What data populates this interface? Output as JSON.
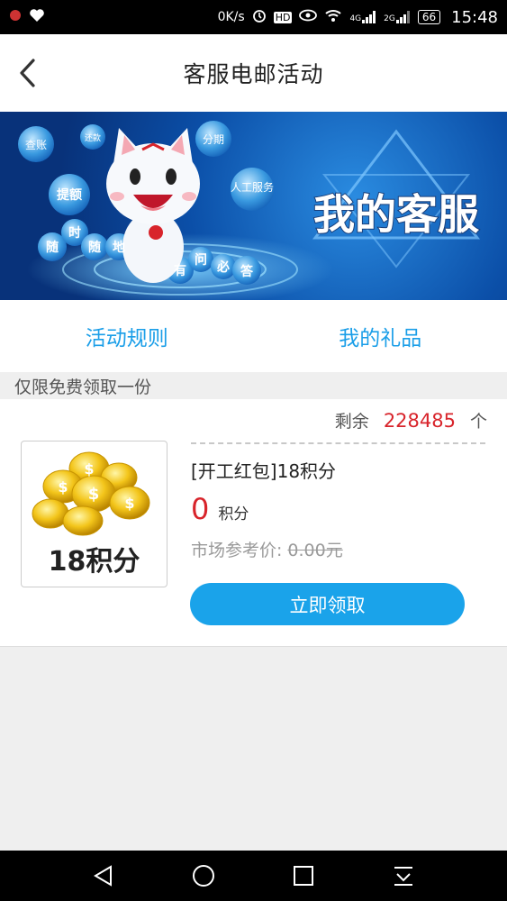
{
  "status_bar": {
    "net_speed": "0K/s",
    "hd": "HD",
    "net1": "4G",
    "net2": "2G",
    "battery": "66",
    "time": "15:48"
  },
  "header": {
    "title": "客服电邮活动"
  },
  "banner": {
    "headline": "我的客服",
    "bubbles": [
      "查账",
      "还款",
      "分期",
      "提额",
      "人工服务"
    ],
    "slogan": [
      "随",
      "时",
      "随",
      "地",
      "有",
      "问",
      "必",
      "答"
    ]
  },
  "tabs": [
    {
      "label": "活动规则"
    },
    {
      "label": "我的礼品"
    }
  ],
  "section": {
    "label": "仅限免费领取一份"
  },
  "gift": {
    "remain_label": "剩余",
    "remain_count": "228485",
    "remain_unit": "个",
    "thumb_caption": "18积分",
    "name": "[开工红包]18积分",
    "points": "0",
    "points_unit": "积分",
    "market_label": "市场参考价:",
    "market_price": "0.00元",
    "claim_label": "立即领取"
  },
  "colors": {
    "accent": "#1aa3ea",
    "price_red": "#d8242b"
  }
}
